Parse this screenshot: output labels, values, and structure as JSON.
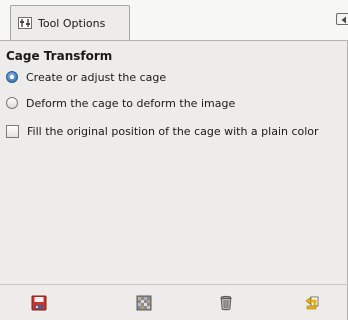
{
  "tab": {
    "label": "Tool Options",
    "icon": "tool-options-icon"
  },
  "panel_menu": {
    "icon": "tab-menu-arrow-icon"
  },
  "tool_options": {
    "title": "Cage Transform",
    "mode_options": [
      {
        "label": "Create or adjust the cage",
        "checked": true
      },
      {
        "label": "Deform the cage to deform the image",
        "checked": false
      }
    ],
    "fill_option": {
      "label": "Fill the original position of the cage with a plain color",
      "checked": false
    }
  },
  "footer_buttons": [
    {
      "icon": "save-options-icon"
    },
    {
      "icon": "restore-options-icon"
    },
    {
      "icon": "delete-options-icon"
    },
    {
      "icon": "reset-options-icon"
    }
  ],
  "colors": {
    "panel_bg": "#edecea",
    "accent_radio": "#4d86c2",
    "save_red": "#c8352a",
    "reset_yellow": "#e4b21a"
  }
}
